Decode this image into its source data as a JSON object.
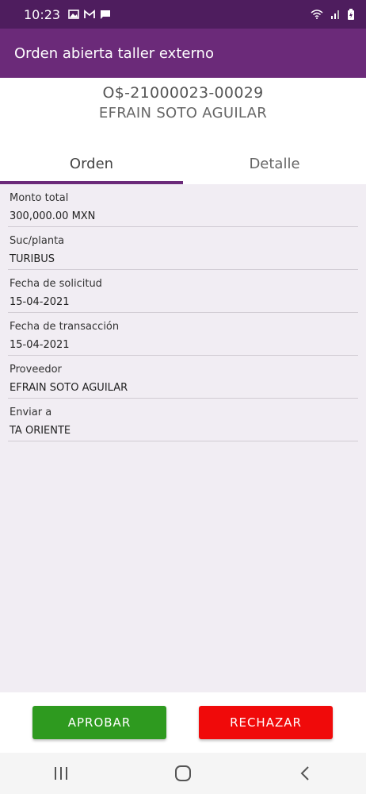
{
  "status_bar": {
    "time": "10:23",
    "left_icons": [
      "image-icon",
      "gmail-icon",
      "message-icon"
    ],
    "right_icons": [
      "wifi-icon",
      "signal-icon",
      "battery-icon"
    ]
  },
  "app_bar": {
    "title": "Orden abierta taller externo"
  },
  "header": {
    "order_id": "O$-21000023-00029",
    "client_name": "EFRAIN SOTO AGUILAR"
  },
  "tabs": [
    {
      "label": "Orden",
      "active": true
    },
    {
      "label": "Detalle",
      "active": false
    }
  ],
  "fields": [
    {
      "label": "Monto total",
      "value": "300,000.00 MXN"
    },
    {
      "label": "Suc/planta",
      "value": "TURIBUS"
    },
    {
      "label": "Fecha de solicitud",
      "value": "15-04-2021"
    },
    {
      "label": "Fecha de transacción",
      "value": "15-04-2021"
    },
    {
      "label": "Proveedor",
      "value": "EFRAIN SOTO AGUILAR"
    },
    {
      "label": "Enviar a",
      "value": "TA ORIENTE"
    }
  ],
  "actions": {
    "approve_label": "APROBAR",
    "reject_label": "RECHAZAR"
  },
  "colors": {
    "status_bar": "#4e1d5e",
    "app_bar": "#6b2a79",
    "approve": "#2e9a1f",
    "reject": "#f00a0a",
    "content_bg": "#f1edf3"
  },
  "nav": [
    "recent-apps-icon",
    "home-icon",
    "back-icon"
  ]
}
